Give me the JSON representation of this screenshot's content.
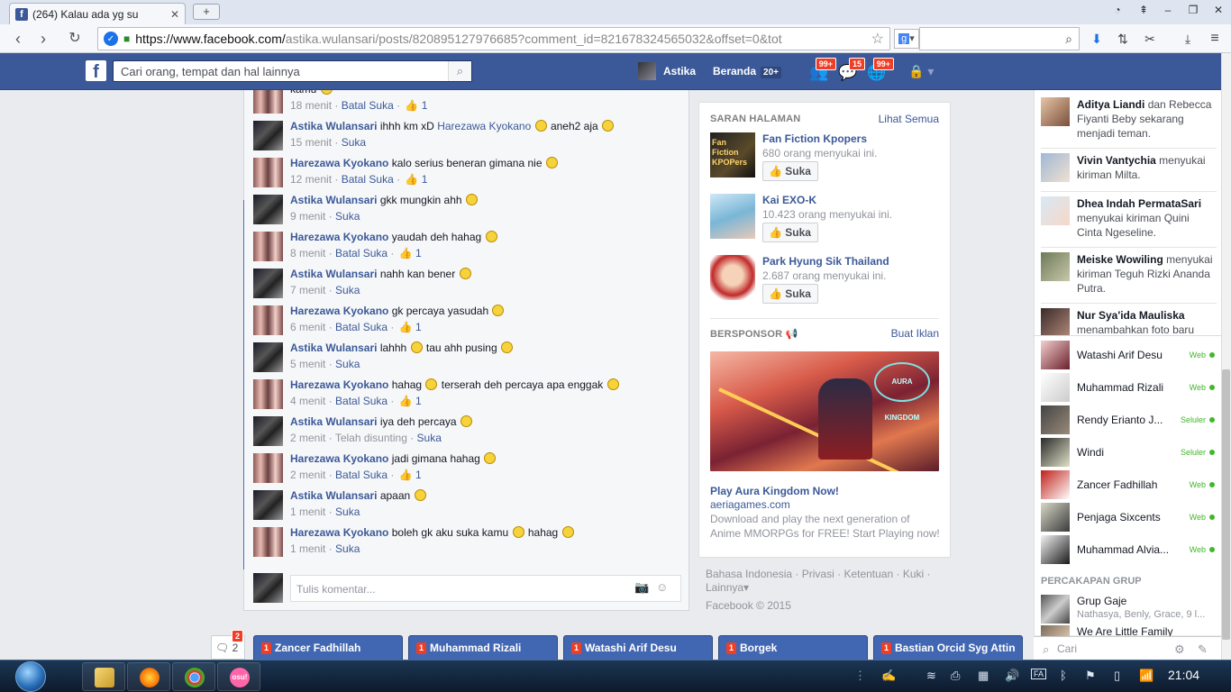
{
  "browser": {
    "tab_title": "(264) Kalau ada yg su",
    "tab_favicon": "f",
    "url_host": "https://www.facebook.com/",
    "url_path": "astika.wulansari/posts/820895127976685?comment_id=821678324565032&offset=0&tot"
  },
  "fb": {
    "search_placeholder": "Cari orang, tempat dan hal lainnya",
    "user_name": "Astika",
    "home_label": "Beranda",
    "home_count": "20+",
    "friend_requests": "99+",
    "messages": "15",
    "notifications": "99+"
  },
  "comments": [
    {
      "author": "",
      "text": "kamu",
      "meta_time": "18 menit",
      "meta_action": "Batal Suka",
      "likes": "1",
      "avatar": "h"
    },
    {
      "author": "Astika Wulansari",
      "text": "ihhh km xD",
      "mention": "Harezawa Kyokano",
      "text2": "aneh2 aja",
      "meta_time": "15 menit",
      "meta_action": "Suka",
      "likes": "",
      "avatar": "a"
    },
    {
      "author": "Harezawa Kyokano",
      "text": "kalo serius beneran gimana nie",
      "meta_time": "12 menit",
      "meta_action": "Batal Suka",
      "likes": "1",
      "avatar": "h"
    },
    {
      "author": "Astika Wulansari",
      "text": "gkk mungkin ahh",
      "meta_time": "9 menit",
      "meta_action": "Suka",
      "likes": "",
      "avatar": "a"
    },
    {
      "author": "Harezawa Kyokano",
      "text": "yaudah deh hahag",
      "meta_time": "8 menit",
      "meta_action": "Batal Suka",
      "likes": "1",
      "avatar": "h"
    },
    {
      "author": "Astika Wulansari",
      "text": "nahh kan bener",
      "meta_time": "7 menit",
      "meta_action": "Suka",
      "likes": "",
      "avatar": "a"
    },
    {
      "author": "Harezawa Kyokano",
      "text": "gk percaya yasudah",
      "meta_time": "6 menit",
      "meta_action": "Batal Suka",
      "likes": "1",
      "avatar": "h"
    },
    {
      "author": "Astika Wulansari",
      "text": "lahhh",
      "text2": "tau ahh pusing",
      "meta_time": "5 menit",
      "meta_action": "Suka",
      "likes": "",
      "avatar": "a"
    },
    {
      "author": "Harezawa Kyokano",
      "text": "hahag",
      "text2": "terserah deh percaya apa enggak",
      "meta_time": "4 menit",
      "meta_action": "Batal Suka",
      "likes": "1",
      "avatar": "h"
    },
    {
      "author": "Astika Wulansari",
      "text": "iya deh percaya",
      "meta_time": "2 menit",
      "meta_extra": "Telah disunting",
      "meta_action": "Suka",
      "likes": "",
      "avatar": "a"
    },
    {
      "author": "Harezawa Kyokano",
      "text": "jadi gimana hahag",
      "meta_time": "2 menit",
      "meta_action": "Batal Suka",
      "likes": "1",
      "avatar": "h"
    },
    {
      "author": "Astika Wulansari",
      "text": "apaan",
      "meta_time": "1 menit",
      "meta_action": "Suka",
      "likes": "",
      "avatar": "a"
    },
    {
      "author": "Harezawa Kyokano",
      "text": "boleh gk aku suka kamu",
      "text2": "hahag",
      "meta_time": "1 menit",
      "meta_action": "Suka",
      "likes": "",
      "avatar": "h"
    }
  ],
  "write_comment_placeholder": "Tulis komentar...",
  "suggestions": {
    "title": "SARAN HALAMAN",
    "see_all": "Lihat Semua",
    "pages": [
      {
        "name": "Fan Fiction Kpopers",
        "likes": "680 orang menyukai ini.",
        "button": "Suka",
        "pic_text": "Fan Fiction KPOPers"
      },
      {
        "name": "Kai EXO-K",
        "likes": "10.423 orang menyukai ini.",
        "button": "Suka"
      },
      {
        "name": "Park Hyung Sik Thailand",
        "likes": "2.687 orang menyukai ini.",
        "button": "Suka"
      }
    ]
  },
  "sponsored": {
    "title": "BERSPONSOR",
    "create_ad": "Buat Iklan",
    "ad_logo": "AURA KINGDOM",
    "ad_title": "Play Aura Kingdom Now!",
    "ad_domain": "aeriagames.com",
    "ad_desc": "Download and play the next generation of Anime MMORPGs for FREE! Start Playing now!"
  },
  "footer": {
    "links": [
      "Bahasa Indonesia",
      "Privasi",
      "Ketentuan",
      "Kuki",
      "Lainnya"
    ],
    "copyright": "Facebook © 2015"
  },
  "ticker": [
    {
      "name": "Aditya Liandi",
      "rest": "dan Rebecca Fiyanti Beby sekarang menjadi teman."
    },
    {
      "name": "Vivin Vantychia",
      "rest": "menyukai kiriman Milta."
    },
    {
      "name": "Dhea Indah PermataSari",
      "rest": "menyukai kiriman Quini Cinta Ngeseline."
    },
    {
      "name": "Meiske Wowiling",
      "rest": "menyukai kiriman Teguh Rizki Ananda Putra."
    },
    {
      "name": "Nur Sya'ida Mauliska",
      "rest": "menambahkan foto baru"
    }
  ],
  "chat_list": [
    {
      "name": "Watashi Arif Desu",
      "status": "Web"
    },
    {
      "name": "Muhammad Rizali",
      "status": "Web"
    },
    {
      "name": "Rendy Erianto J...",
      "status": "Seluler"
    },
    {
      "name": "Windi",
      "status": "Seluler"
    },
    {
      "name": "Zancer Fadhillah",
      "status": "Web"
    },
    {
      "name": "Penjaga Sixcents",
      "status": "Web"
    },
    {
      "name": "Muhammad Alvia...",
      "status": "Web"
    }
  ],
  "group_chats": {
    "title": "PERCAKAPAN GRUP",
    "groups": [
      {
        "name": "Grup Gaje",
        "members": "Nathasya, Benly, Grace, 9 l..."
      },
      {
        "name": "We Are Little Family",
        "members": ""
      }
    ]
  },
  "chat_search_placeholder": "Cari",
  "chat_tabs": {
    "jewel_count": "2",
    "jewel_badge": "2",
    "tabs": [
      {
        "count": "1",
        "name": "Zancer Fadhillah"
      },
      {
        "count": "1",
        "name": "Muhammad Rizali"
      },
      {
        "count": "1",
        "name": "Watashi Arif Desu"
      },
      {
        "count": "1",
        "name": "Borgek"
      },
      {
        "count": "1",
        "name": "Bastian Orcid Syg Attin"
      }
    ]
  },
  "taskbar": {
    "clock": "21:04",
    "apps": [
      "file-explorer",
      "firefox",
      "chrome",
      "osu"
    ],
    "osu_label": "osu!"
  },
  "colors": {
    "fb_blue": "#3b5998",
    "badge_red": "#f03d25",
    "online_green": "#42b72a"
  }
}
